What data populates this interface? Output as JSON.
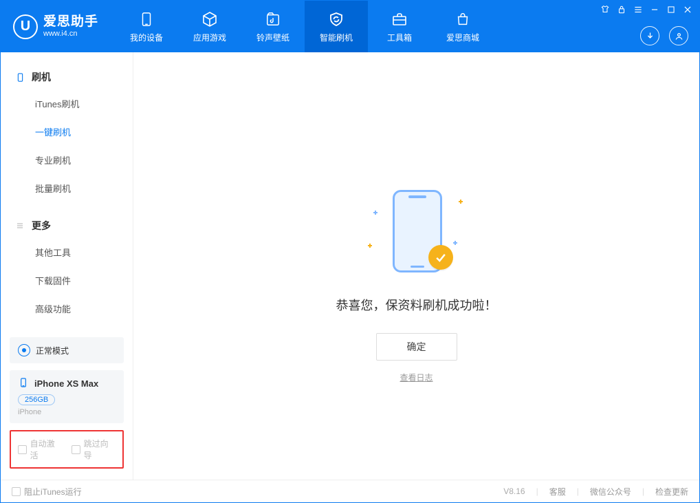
{
  "brand": {
    "name": "爱思助手",
    "url": "www.i4.cn"
  },
  "tabs": {
    "device": "我的设备",
    "apps": "应用游戏",
    "ringtone": "铃声壁纸",
    "flash": "智能刷机",
    "toolbox": "工具箱",
    "store": "爱思商城"
  },
  "sidebar": {
    "group_flash": "刷机",
    "items_flash": {
      "itunes": "iTunes刷机",
      "oneclick": "一键刷机",
      "pro": "专业刷机",
      "batch": "批量刷机"
    },
    "group_more": "更多",
    "items_more": {
      "other": "其他工具",
      "firmware": "下载固件",
      "advanced": "高级功能"
    }
  },
  "mode_card": {
    "label": "正常模式"
  },
  "device_card": {
    "name": "iPhone XS Max",
    "storage": "256GB",
    "type": "iPhone"
  },
  "bottom_opts": {
    "auto_activate": "自动激活",
    "skip_guide": "跳过向导"
  },
  "main": {
    "success_text": "恭喜您，保资料刷机成功啦！",
    "ok_button": "确定",
    "view_log": "查看日志"
  },
  "footer": {
    "block_itunes": "阻止iTunes运行",
    "version": "V8.16",
    "support": "客服",
    "wechat": "微信公众号",
    "update": "检查更新"
  }
}
